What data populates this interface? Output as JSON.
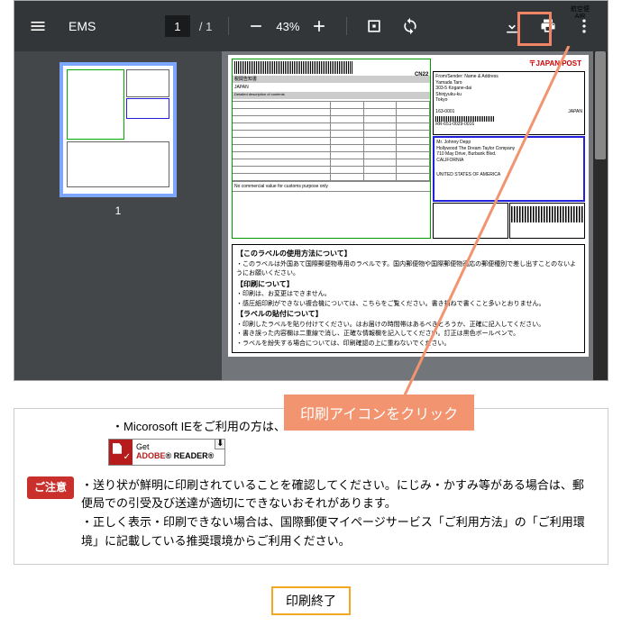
{
  "toolbar": {
    "title": "EMS",
    "page_current": "1",
    "page_sep": "/ 1",
    "zoom_level": "43%"
  },
  "thumb": {
    "page_num": "1"
  },
  "doc": {
    "airmail": {
      "l1": "航空便",
      "l2": "AIR"
    },
    "jp_post": "JAPAN POST",
    "decl_title_l": "税関告知書",
    "decl_title_r": "CN22",
    "japan": "JAPAN",
    "no_commercial": "No commercial value for customs purpose only",
    "from_label": "From/Sender: Name & Address",
    "from_addr": "Yamada Taro\n303-5 Kogane-dai\nShinjyuku-ku\nTokyo",
    "from_post": "163-0001",
    "from_country": "JAPAN",
    "tracking_no": "RR-651-0029-0016",
    "to_name": "Mr. Johnny Depp",
    "to_addr": "Hollywood The Dream Taylor Company\n710 May Drive, Burbank Blvd.\nCALIFORNIA",
    "to_country": "UNITED STATES OF AMERICA"
  },
  "instr_panel": {
    "h1": "【このラベルの使用方法について】",
    "p1": "・このラベルは外国あて国際郵便物専用のラベルです。国内郵便物や国際郵便物適応の郵便種別で差し出すことのないようにお願いください。",
    "h2": "【印刷について】",
    "p2": "・印刷は、お変更はできません。",
    "p3": "・感圧紙印刷ができない複合機については、こちらをご覧ください。書き損ねで書くこと多いとおりません。",
    "h3": "【ラベルの貼付について】",
    "p4": "・印刷したラベルを貼り付けてください。はお届けの時間帯はあるべきとろうか、正確に記入してください。",
    "p5": "・書き誤った内容欄は二重線で消し、正確な情報欄を記入してください。訂正は黒色ボールペンで。",
    "p6": "・ラベルを紛失する場合については、印刷確認の上に重ねないでください。"
  },
  "callout": {
    "text": "印刷アイコンをクリック"
  },
  "instructions": {
    "ie_line": "・Micorosoft IEをご利用の方は、",
    "adobe": {
      "get": "Get",
      "reader": "READER",
      "brand": "ADOBE"
    },
    "notice_label": "ご注意",
    "bullet1": "・送り状が鮮明に印刷されていることを確認してください。にじみ・かすみ等がある場合は、郵便局での引受及び送達が適切にできないおそれがあります。",
    "bullet2": "・正しく表示・印刷できない場合は、国際郵便マイページサービス「ご利用方法」の「ご利用環境」に記載している推奨環境からご利用ください。"
  },
  "finish_button": "印刷終了"
}
